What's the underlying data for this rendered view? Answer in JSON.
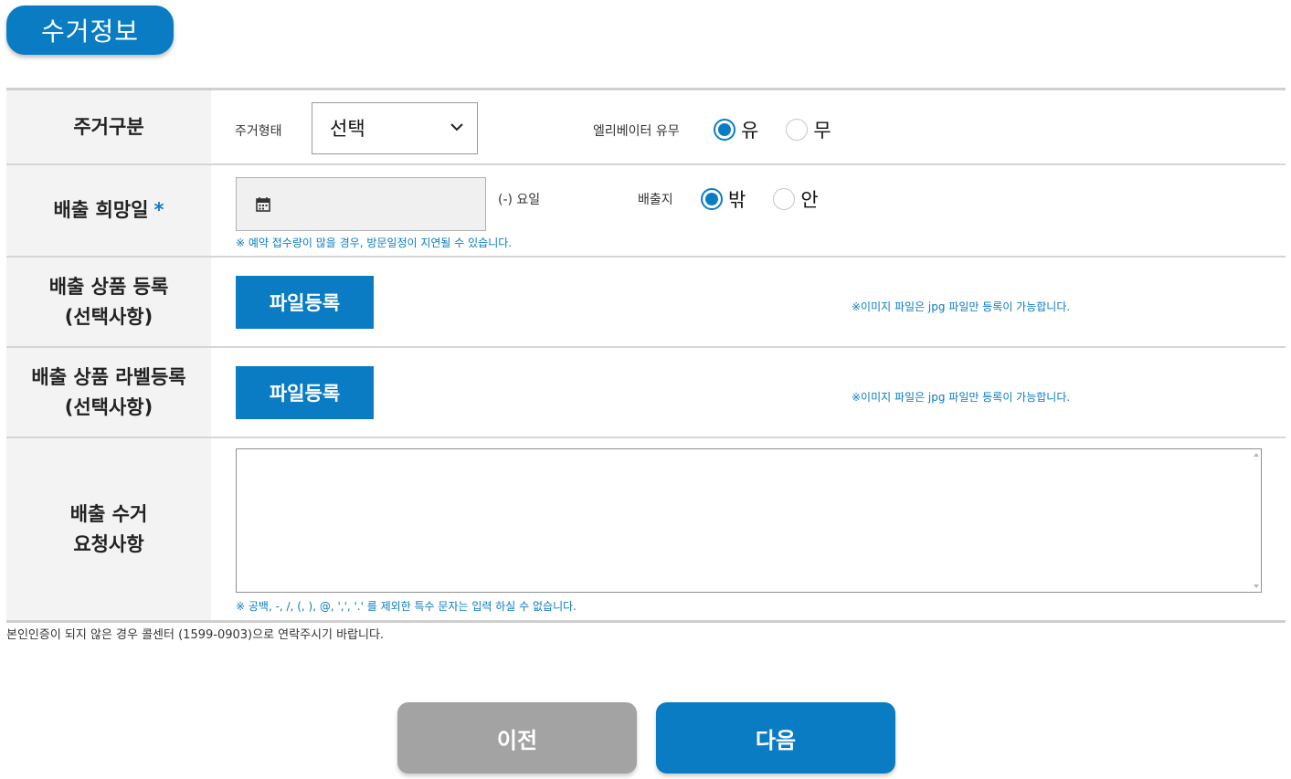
{
  "section_title": "수거정보",
  "rows": {
    "residence": {
      "label": "주거구분",
      "type_label": "주거형태",
      "type_value": "선택",
      "elevator_label": "엘리베이터 유무",
      "elevator_options": [
        "유",
        "무"
      ],
      "elevator_selected": "유"
    },
    "date": {
      "label": "배출 희망일",
      "required_mark": "*",
      "weekday": "(-) 요일",
      "place_label": "배출지",
      "place_options": [
        "밖",
        "안"
      ],
      "place_selected": "밖",
      "note": "※ 예약 접수량이 많을 경우, 방문일정이 지연될 수 있습니다."
    },
    "product_reg": {
      "label_line1": "배출 상품 등록",
      "label_line2": "(선택사항)",
      "button": "파일등록",
      "note": "※이미지 파일은 jpg 파일만 등록이 가능합니다."
    },
    "label_reg": {
      "label_line1": "배출 상품 라벨등록",
      "label_line2": "(선택사항)",
      "button": "파일등록",
      "note": "※이미지 파일은 jpg 파일만 등록이 가능합니다."
    },
    "request": {
      "label_line1": "배출 수거",
      "label_line2": "요청사항",
      "value": "",
      "note": "※ 공백, -, /, (, ), @, ',', '.' 를 제외한 특수 문자는 입력 하실 수 없습니다."
    }
  },
  "footer_note": "본인인증이 되지 않은 경우 콜센터 (1599-0903)으로 연락주시기 바랍니다.",
  "buttons": {
    "prev": "이전",
    "next": "다음"
  },
  "colors": {
    "accent": "#0a7cc4",
    "disabled": "#a3a3a3"
  }
}
